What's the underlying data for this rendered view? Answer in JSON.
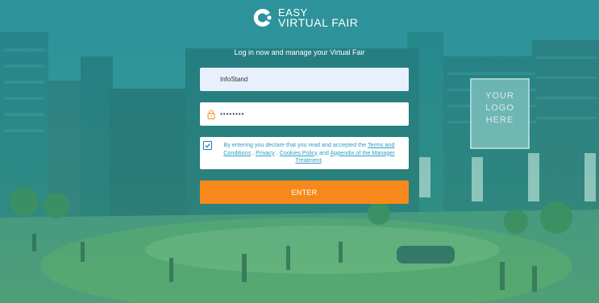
{
  "logo": {
    "line1": "EASY",
    "line2": "VIRTUAL FAIR"
  },
  "tagline": "Log in now and manage your Virtual Fair",
  "username": {
    "value": "InfoStand"
  },
  "password": {
    "value": "••••••••"
  },
  "billboard": {
    "line1": "YOUR",
    "line2": "LOGO",
    "line3": "HERE"
  },
  "terms": {
    "checked": true,
    "prefix": "By entering you declare that you read and accepted the ",
    "link_terms": "Terms and Conditions",
    "sep1": " , ",
    "link_privacy": "Privacy",
    "sep2": " , ",
    "link_cookies": "Cookies Policy",
    "sep3": " and ",
    "link_appendix": "Appendix of the Manager Treatment",
    "suffix": "."
  },
  "enter_button": {
    "label": "ENTER"
  },
  "colors": {
    "accent_orange": "#f7891c",
    "link_blue": "#2a9fc4",
    "overlay_teal": "#2e8f94"
  },
  "icons": {
    "lock": "lock-icon",
    "logo": "logo-mark-icon",
    "check": "checkmark-icon"
  }
}
